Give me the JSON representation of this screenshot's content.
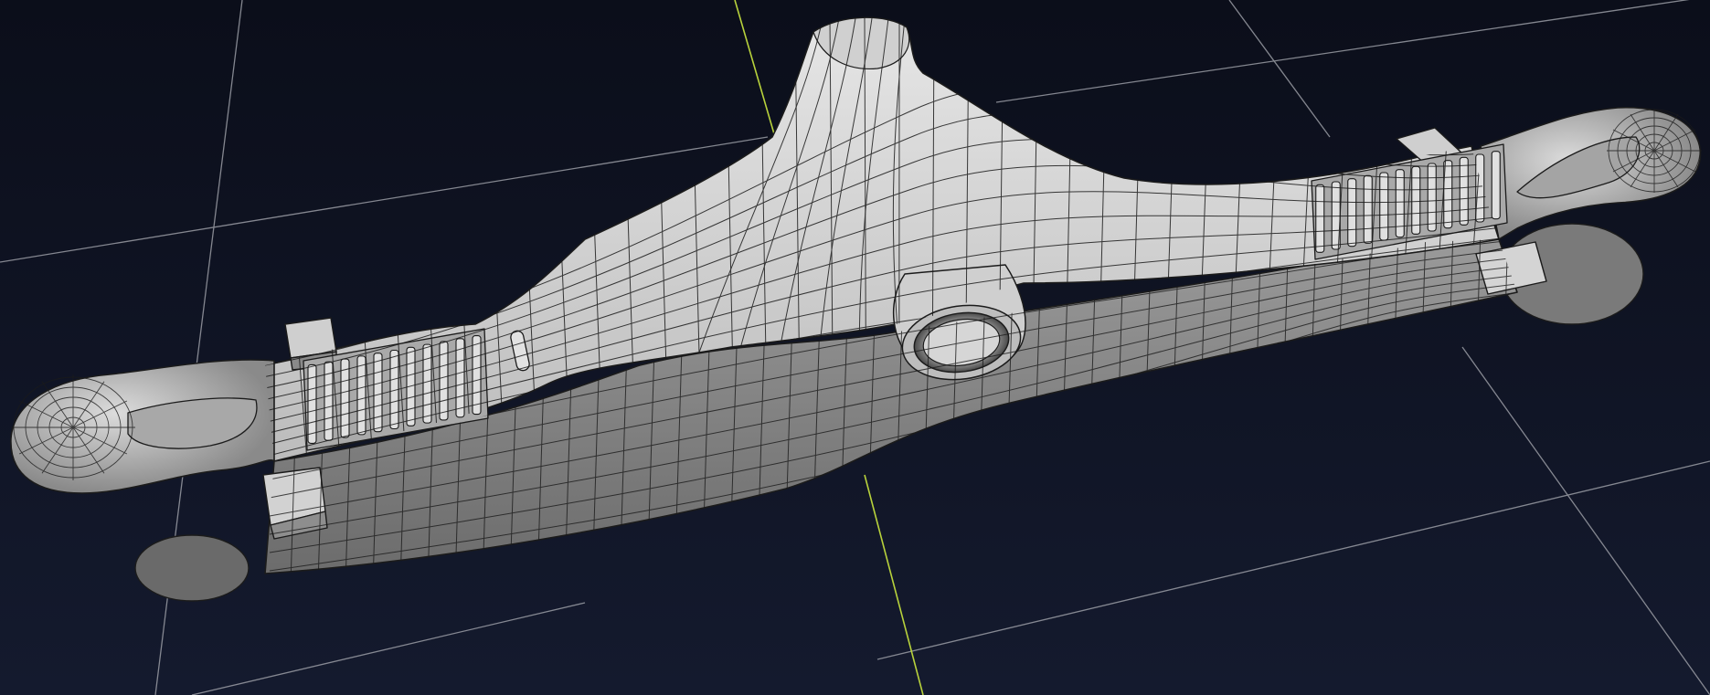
{
  "viewport": {
    "label": "3d-viewport",
    "background_top": "#0b0e1a",
    "background_bottom": "#141a2e",
    "grid_color": "#9a9ca4",
    "axis_color": "#b8d23c",
    "mesh_fill": "#b6b6b6",
    "mesh_shadow": "#5c5c5c",
    "mesh_highlight": "#e4e4e4",
    "wire_color": "#1b1b1b"
  },
  "model": {
    "object": "suspension-control-arm",
    "display_mode": "wireframe-on-shaded"
  }
}
